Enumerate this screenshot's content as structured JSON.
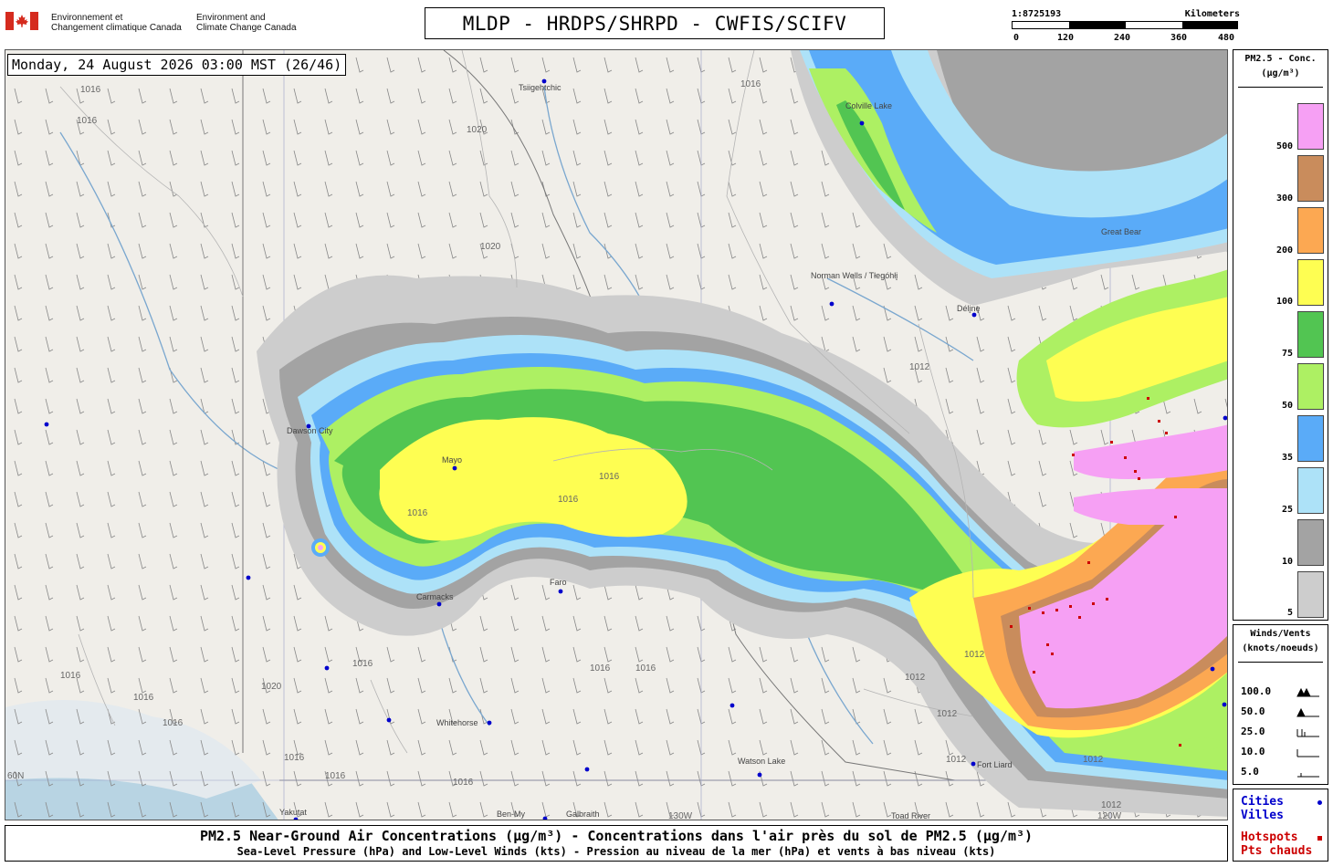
{
  "header": {
    "agency_fr_line1": "Environnement et",
    "agency_fr_line2": "Changement climatique Canada",
    "agency_en_line1": "Environment and",
    "agency_en_line2": "Climate Change Canada",
    "title": "MLDP - HRDPS/SHRPD - CWFIS/SCIFV"
  },
  "scale": {
    "ratio": "1:8725193",
    "unit": "Kilometers",
    "ticks": [
      "0",
      "120",
      "240",
      "360",
      "480"
    ]
  },
  "map": {
    "timestamp": "Monday, 24 August 2026 03:00 MST (26/46)",
    "cities": [
      {
        "name": "Tsiigehtchic"
      },
      {
        "name": "Colville Lake"
      },
      {
        "name": "Norman Wells / Tłegóhłį"
      },
      {
        "name": "Délįnę"
      },
      {
        "name": "Great Bear"
      },
      {
        "name": "Dawson City"
      },
      {
        "name": "Mayo"
      },
      {
        "name": "Carmacks"
      },
      {
        "name": "Faro"
      },
      {
        "name": "Whitehorse"
      },
      {
        "name": "Watson Lake"
      },
      {
        "name": "Fort Liard"
      },
      {
        "name": "Yakutat"
      },
      {
        "name": "Ben-My"
      },
      {
        "name": "Galbraith"
      },
      {
        "name": "Toad River"
      }
    ],
    "isobar_labels": [
      "1016",
      "1016",
      "1020",
      "1020",
      "1016",
      "1012",
      "1016",
      "1016",
      "1016",
      "1020",
      "1016",
      "1016",
      "1016",
      "1016",
      "1012",
      "1012",
      "1012",
      "1016",
      "1016",
      "1016",
      "1016",
      "1016",
      "1012",
      "1012",
      "1012"
    ],
    "graticule_labels": [
      "60N",
      "130W",
      "120W"
    ]
  },
  "legend": {
    "title_line1": "PM2.5 - Conc.",
    "title_line2": "(µg/m³)",
    "bins": [
      {
        "label": "500",
        "color": "#f6a0f4"
      },
      {
        "label": "300",
        "color": "#c98c5c"
      },
      {
        "label": "200",
        "color": "#fca852"
      },
      {
        "label": "100",
        "color": "#fefe52"
      },
      {
        "label": "75",
        "color": "#52c552"
      },
      {
        "label": "50",
        "color": "#adf063"
      },
      {
        "label": "35",
        "color": "#5aabf8"
      },
      {
        "label": "25",
        "color": "#ade2f8"
      },
      {
        "label": "10",
        "color": "#a3a3a3"
      },
      {
        "label": "5",
        "color": "#cdcdcd"
      }
    ]
  },
  "wind_legend": {
    "title_line1": "Winds/Vents",
    "title_line2": "(knots/noeuds)",
    "rows": [
      "100.0",
      "50.0",
      "25.0",
      "10.0",
      "5.0"
    ]
  },
  "points_legend": {
    "cities_en": "Cities",
    "cities_fr": "Villes",
    "hotspots_en": "Hotspots",
    "hotspots_fr": "Pts chauds",
    "city_color": "#0000cc",
    "hotspot_color": "#cc0000"
  },
  "footer": {
    "line1": "PM2.5 Near-Ground Air Concentrations (µg/m³) - Concentrations dans l'air près du sol de PM2.5 (µg/m³)",
    "line2": "Sea-Level Pressure (hPa) and Low-Level Winds (kts) - Pression au niveau de la mer (hPa) et vents à bas niveau (kts)"
  }
}
